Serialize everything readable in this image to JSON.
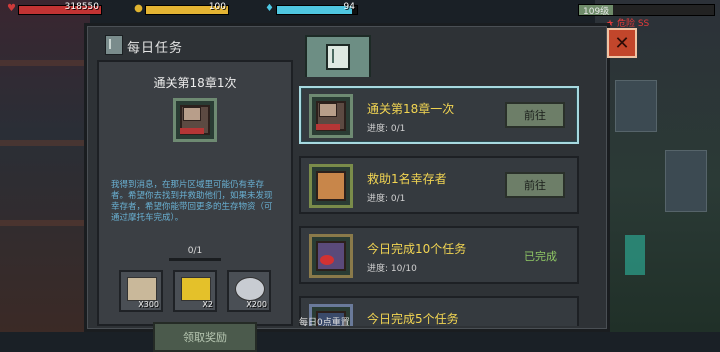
{
  "hud": {
    "health_value": "318550",
    "energy_value": "100",
    "water_value": "94",
    "health_fill": 1.0,
    "energy_fill": 1.0,
    "water_fill": 0.94,
    "level_text": "109级",
    "danger_text": "危险",
    "danger_value": "SS"
  },
  "window": {
    "title": "每日任务",
    "reset_note": "每日0点重置",
    "close_icon": "close-icon"
  },
  "detail": {
    "title": "通关第18章1次",
    "description": "我得到消息，在那片区域里可能仍有幸存者。希望你去找到并救助他们，如果未发现幸存者，希望你能带回更多的生存物资（可通过摩托车完成）。",
    "progress_text": "0/1",
    "progress_fill": 0,
    "rewards": [
      {
        "icon": "bullet-box-icon",
        "qty": "X300"
      },
      {
        "icon": "chips-bag-icon",
        "qty": "X2"
      },
      {
        "icon": "metal-part-icon",
        "qty": "X200"
      }
    ],
    "claim_label": "领取奖励"
  },
  "tasks": [
    {
      "name": "通关第18章一次",
      "progress": "进度: 0/1",
      "action": "前往",
      "status": "",
      "icon": "eagle-emblem-icon",
      "selected": true
    },
    {
      "name": "救助1名幸存者",
      "progress": "进度: 0/1",
      "action": "前往",
      "status": "",
      "icon": "fist-emblem-icon",
      "selected": false
    },
    {
      "name": "今日完成10个任务",
      "progress": "进度: 10/10",
      "action": "",
      "status": "已完成",
      "icon": "heart-emblem-icon",
      "selected": false
    },
    {
      "name": "今日完成5个任务",
      "progress": "",
      "action": "",
      "status": "",
      "icon": "badge-emblem-icon",
      "selected": false
    }
  ],
  "colors": {
    "task_name": "#f2d552",
    "description": "#69b0d2",
    "completed": "#8fc764",
    "close_button": "#c2462b"
  }
}
